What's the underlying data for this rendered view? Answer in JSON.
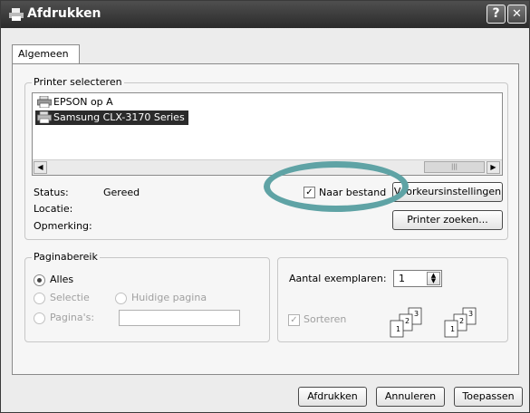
{
  "window": {
    "title": "Afdrukken",
    "help_glyph": "?",
    "close_glyph": "✕"
  },
  "tabs": [
    {
      "label": "Algemeen"
    }
  ],
  "printer_select": {
    "group_label": "Printer selecteren",
    "printers": [
      {
        "name": "EPSON op A"
      },
      {
        "name": "Samsung CLX-3170 Series"
      }
    ],
    "scroll_left": "◀",
    "scroll_right": "▶",
    "scroll_thumb": "|||"
  },
  "status": {
    "status_label": "Status:",
    "status_value": "Gereed",
    "location_label": "Locatie:",
    "comment_label": "Opmerking:"
  },
  "options": {
    "print_to_file_label": "Naar bestand",
    "print_to_file_checked": true,
    "preferences_button": "Voorkeursinstellingen",
    "find_printer_button": "Printer zoeken..."
  },
  "page_range": {
    "group_label": "Paginabereik",
    "all": "Alles",
    "selection": "Selectie",
    "current_page": "Huidige pagina",
    "pages": "Pagina's:"
  },
  "copies": {
    "label": "Aantal exemplaren:",
    "value": "1",
    "collate_label": "Sorteren",
    "collate_checked": true
  },
  "footer": {
    "print_button": "Afdrukken",
    "cancel_button": "Annuleren",
    "apply_button": "Toepassen"
  },
  "colors": {
    "highlight": "#5fa3a5",
    "selected_row": "#2b2b2b"
  }
}
